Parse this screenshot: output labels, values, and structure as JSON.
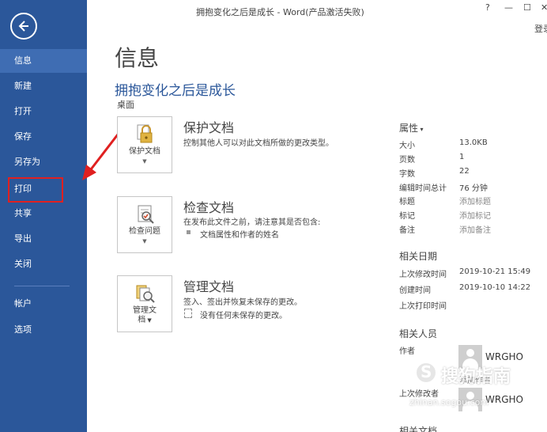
{
  "window": {
    "title": "拥抱变化之后是成长 - Word(产品激活失败)",
    "help": "?",
    "minimize": "—",
    "maximize": "☐",
    "close": "✕",
    "login": "登录"
  },
  "sidebar": {
    "items": [
      {
        "label": "信息"
      },
      {
        "label": "新建"
      },
      {
        "label": "打开"
      },
      {
        "label": "保存"
      },
      {
        "label": "另存为"
      },
      {
        "label": "打印"
      },
      {
        "label": "共享"
      },
      {
        "label": "导出"
      },
      {
        "label": "关闭"
      },
      {
        "label": "帐户"
      },
      {
        "label": "选项"
      }
    ],
    "active_color": "#3f6db3",
    "bg_color": "#2b579a"
  },
  "main": {
    "page_title": "信息",
    "doc_title": "拥抱变化之后是成长",
    "doc_location": "桌面",
    "sections": [
      {
        "tile_label": "保护文档",
        "heading": "保护文档",
        "desc": "控制其他人可以对此文档所做的更改类型。",
        "icon": "lock-icon"
      },
      {
        "tile_label": "检查问题",
        "heading": "检查文档",
        "desc": "在发布此文件之前，请注意其是否包含:",
        "bullet": "文档属性和作者的姓名",
        "icon": "inspect-icon"
      },
      {
        "tile_label_line1": "管理文",
        "tile_label_line2": "档",
        "heading": "管理文档",
        "desc": "签入、签出并恢复未保存的更改。",
        "bullet": "没有任何未保存的更改。",
        "icon": "manage-document-icon"
      }
    ]
  },
  "properties": {
    "heading": "属性",
    "rows": [
      {
        "label": "大小",
        "value": "13.0KB"
      },
      {
        "label": "页数",
        "value": "1"
      },
      {
        "label": "字数",
        "value": "22"
      },
      {
        "label": "编辑时间总计",
        "value": "76 分钟"
      },
      {
        "label": "标题",
        "value": "添加标题"
      },
      {
        "label": "标记",
        "value": "添加标记"
      },
      {
        "label": "备注",
        "value": "添加备注"
      }
    ],
    "dates_heading": "相关日期",
    "dates": [
      {
        "label": "上次修改时间",
        "value": "2019-10-21 15:49"
      },
      {
        "label": "创建时间",
        "value": "2019-10-10 14:22"
      },
      {
        "label": "上次打印时间",
        "value": ""
      }
    ],
    "people_heading": "相关人员",
    "author_label": "作者",
    "author_name": "WRGHO",
    "author_add": "添加作者",
    "last_modified_by_label": "上次修改者",
    "last_modified_by_name": "WRGHO",
    "docs_heading": "相关文档"
  },
  "watermark": {
    "text": "搜狗指南",
    "url": "zhinan.sogou.com"
  }
}
